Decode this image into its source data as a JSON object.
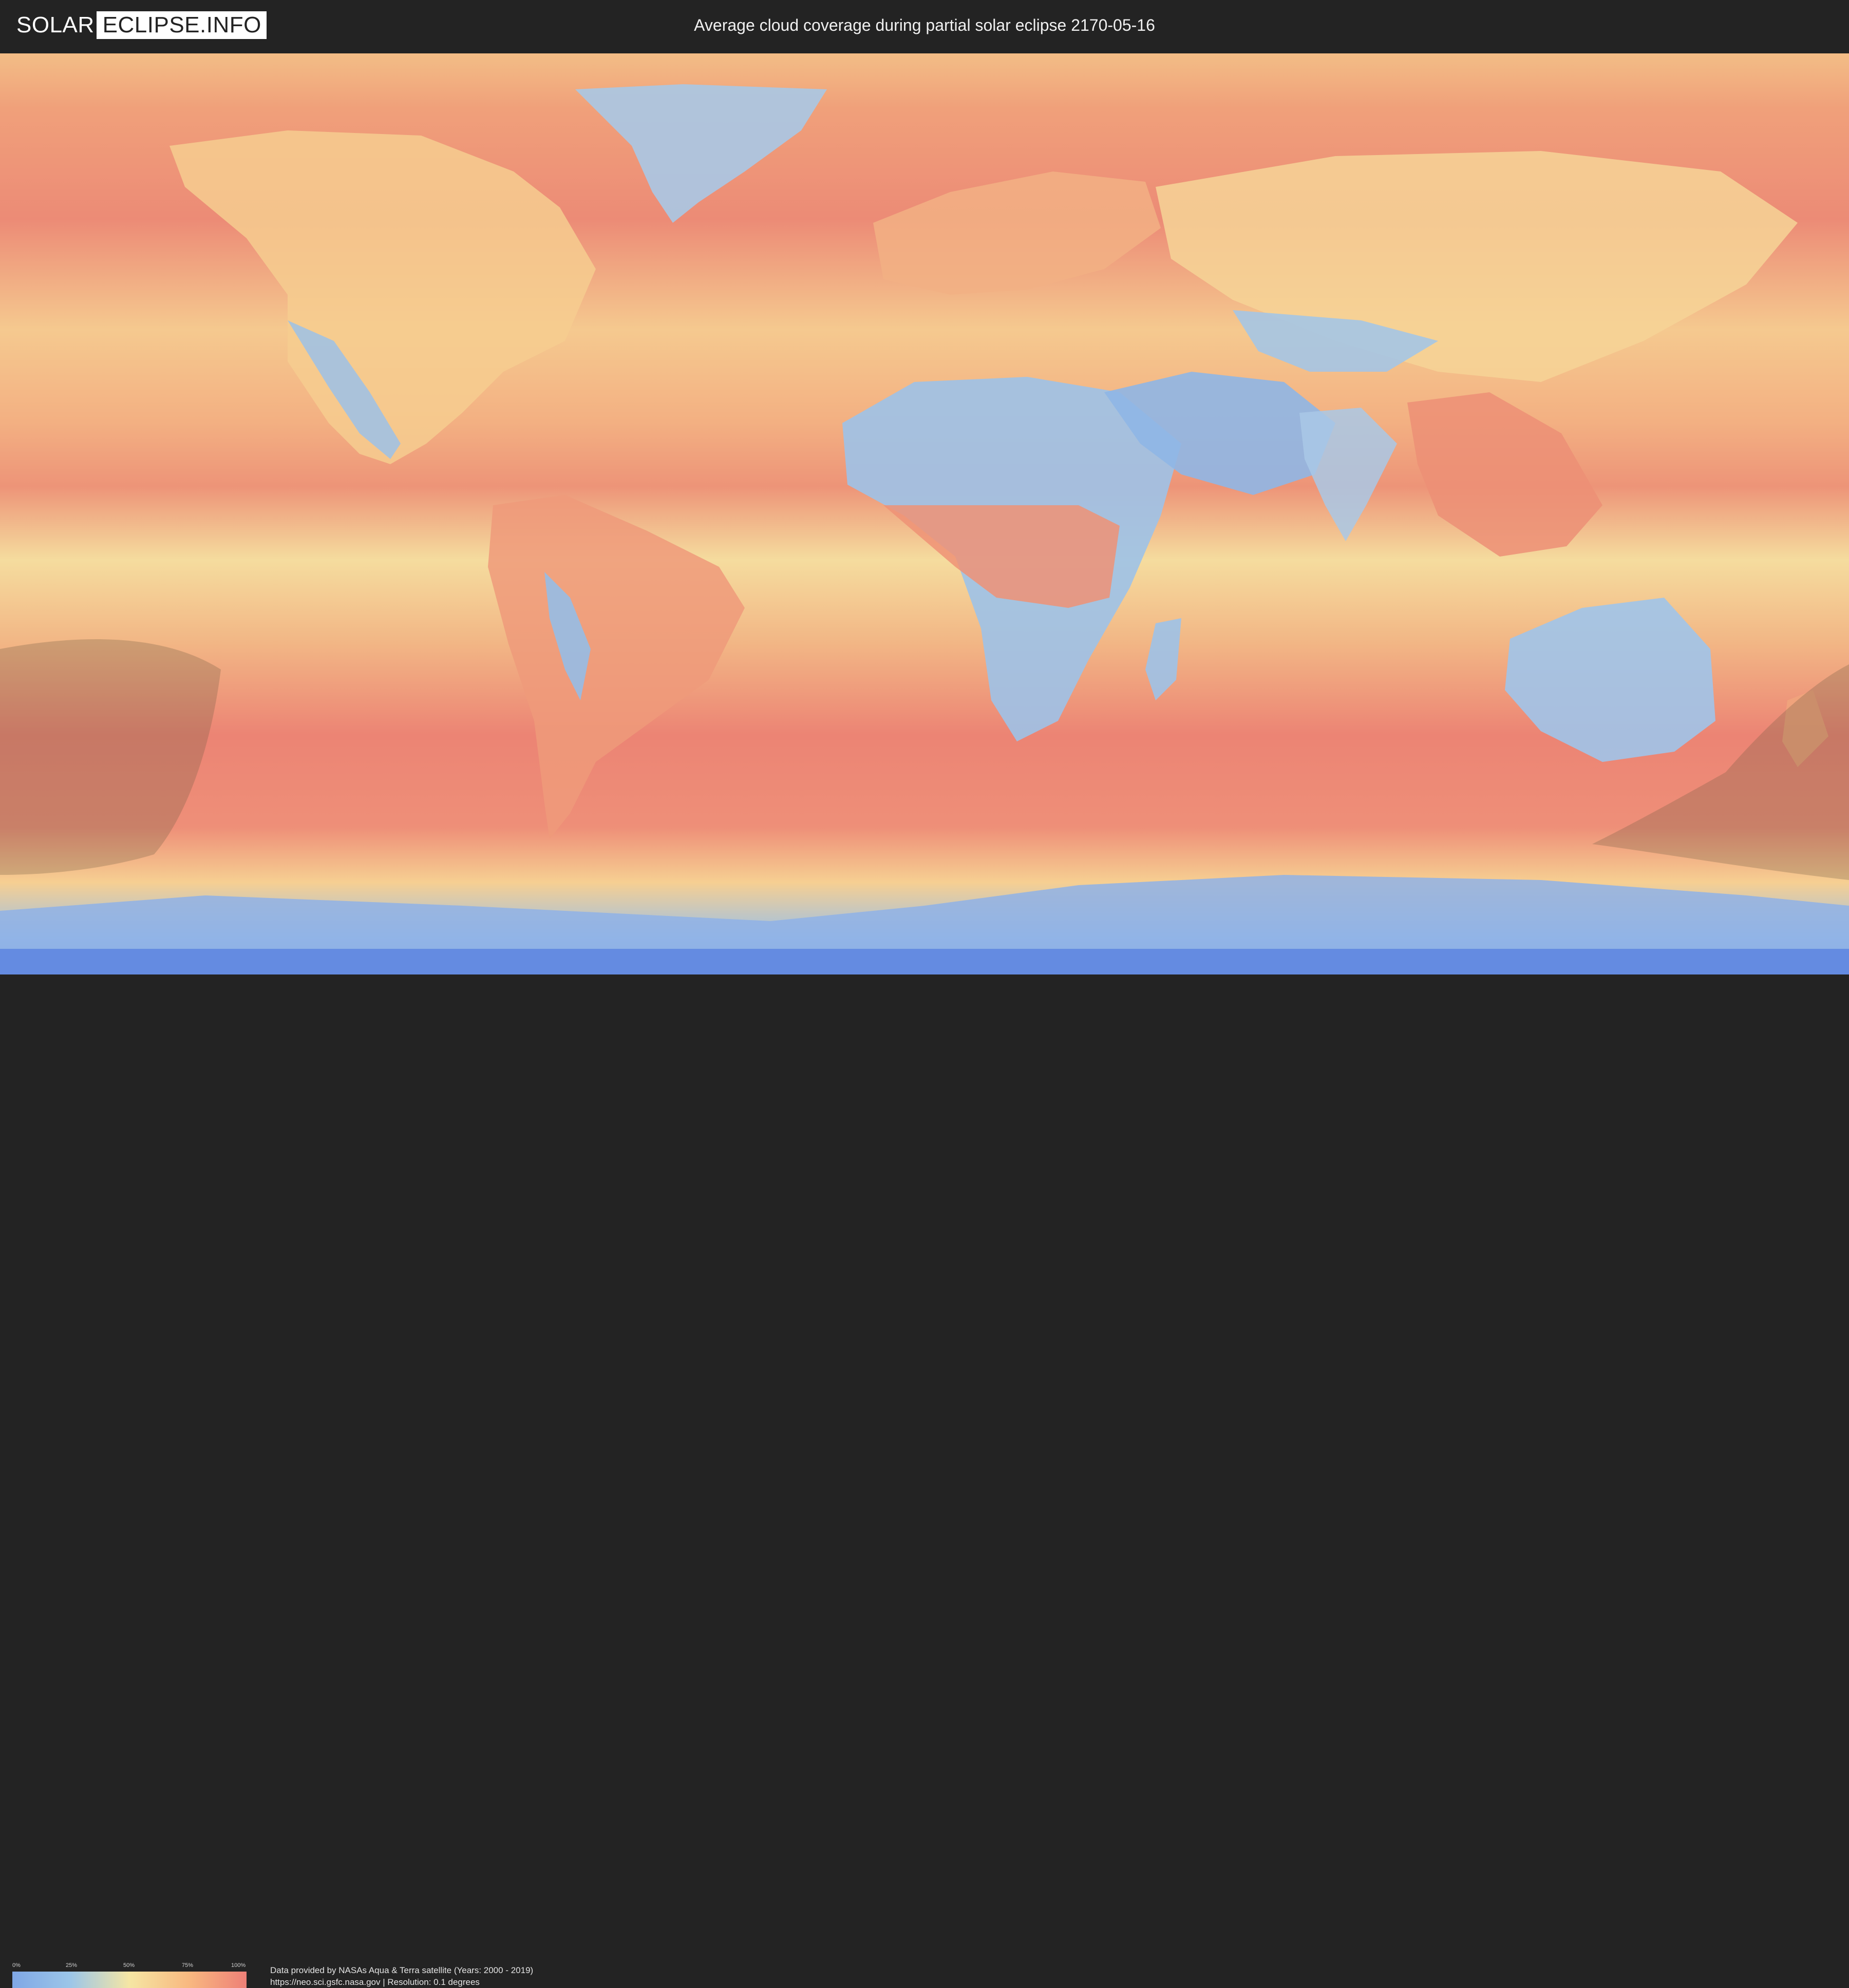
{
  "header": {
    "logo_part1": "SOLAR",
    "logo_part2": "ECLIPSE.INFO",
    "title": "Average cloud coverage during partial solar eclipse 2170-05-16"
  },
  "map": {
    "description_kind": "cloud-coverage-world-map"
  },
  "legend": {
    "ticks": [
      "0%",
      "25%",
      "50%",
      "75%",
      "100%"
    ],
    "colors": [
      "#7fa7e6",
      "#9cc6e8",
      "#f5e6a4",
      "#f8b980",
      "#ee8077"
    ]
  },
  "credits": {
    "line1": "Data provided by NASAs Aqua & Terra satellite (Years: 2000 - 2019)",
    "line2": "https://neo.sci.gsfc.nasa.gov | Resolution: 0.1 degrees"
  }
}
